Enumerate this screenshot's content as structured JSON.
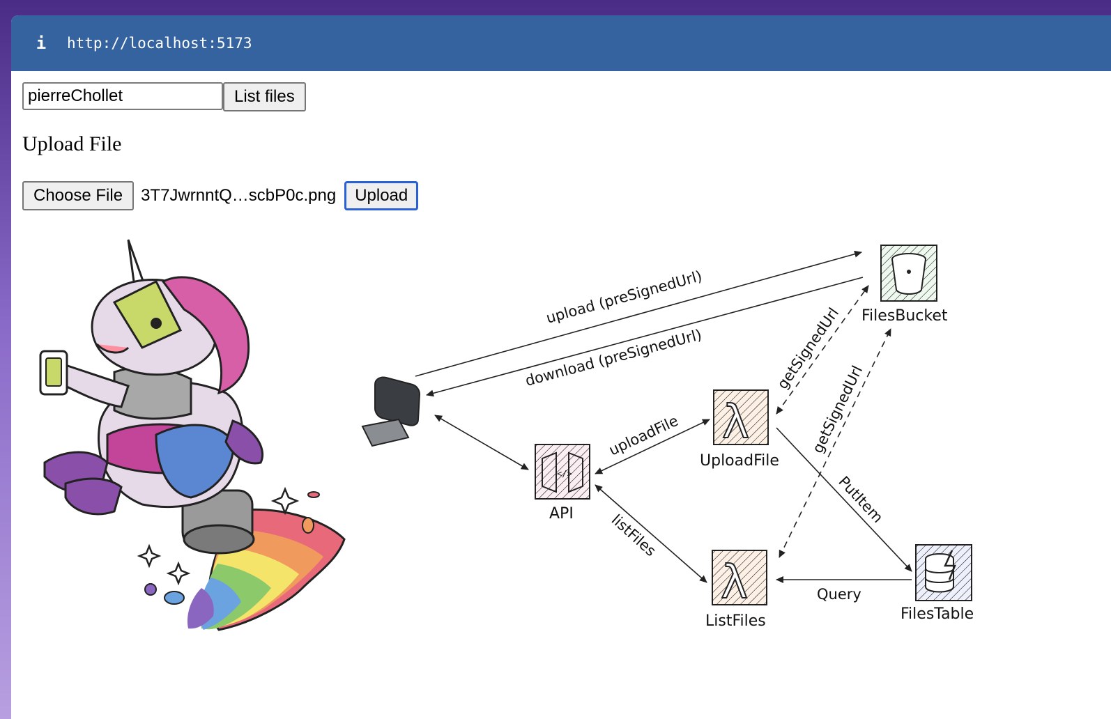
{
  "browser": {
    "url": "http://localhost:5173",
    "info_icon": "info-icon"
  },
  "form": {
    "username_value": "pierreChollet",
    "list_files_label": "List files",
    "upload_heading": "Upload File",
    "choose_file_label": "Choose File",
    "selected_file": "3T7JwrnntQ…scbP0c.png",
    "upload_label": "Upload"
  },
  "diagram": {
    "nodes": {
      "client": "computer-icon",
      "api": "API",
      "upload_file": "UploadFile",
      "list_files": "ListFiles",
      "files_bucket": "FilesBucket",
      "files_table": "FilesTable"
    },
    "edges": {
      "upload": "upload (preSignedUrl)",
      "download": "download (preSignedUrl)",
      "upload_file": "uploadFile",
      "list_files": "listFiles",
      "get_signed_url_1": "getSignedUrl",
      "get_signed_url_2": "getSignedUrl",
      "put_item": "PutItem",
      "query": "Query"
    },
    "colors": {
      "lambda": "#f3a46b",
      "api": "#e78aa8",
      "bucket": "#7cc27c",
      "table": "#6a7fd6"
    }
  }
}
